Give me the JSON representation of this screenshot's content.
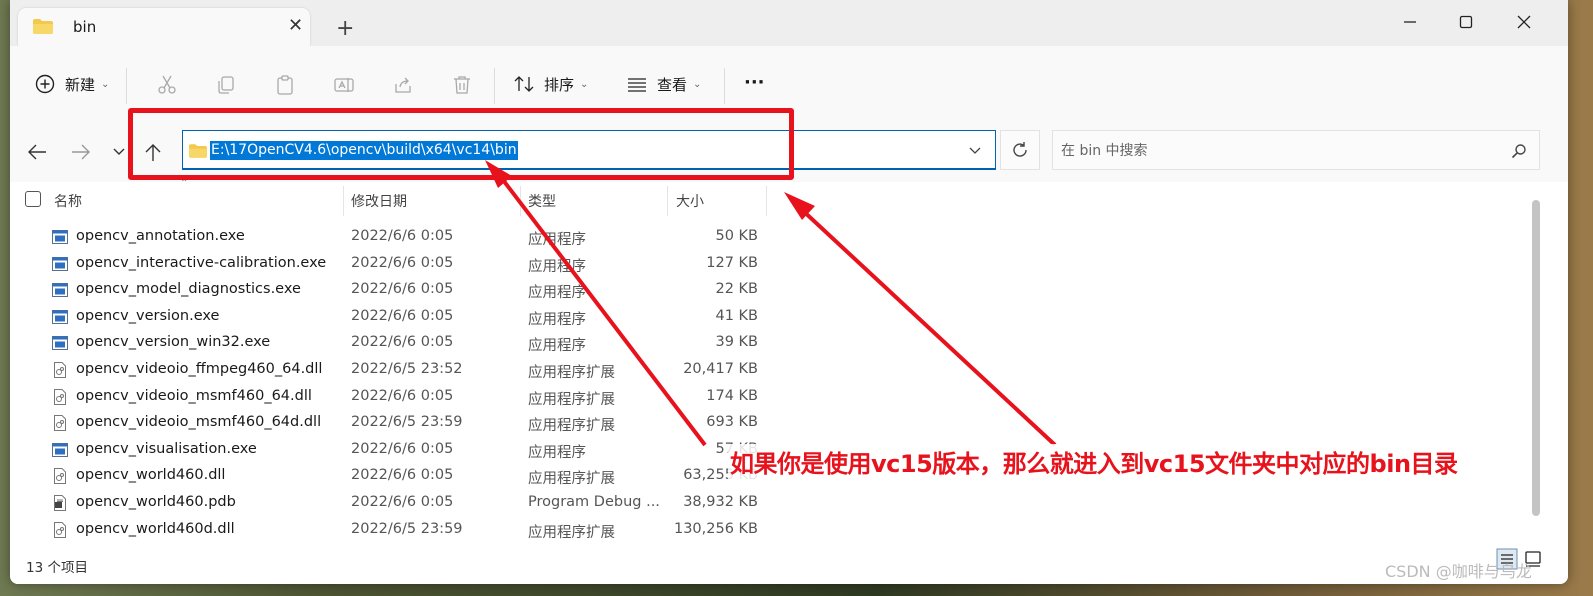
{
  "tab": {
    "title": "bin"
  },
  "toolbar": {
    "new_label": "新建",
    "sort_label": "排序",
    "view_label": "查看",
    "more_label": "···"
  },
  "address": {
    "path": "E:\\17OpenCV4.6\\opencv\\build\\x64\\vc14\\bin"
  },
  "search": {
    "placeholder": "在 bin 中搜索"
  },
  "columns": {
    "name": "名称",
    "date": "修改日期",
    "type": "类型",
    "size": "大小"
  },
  "files": [
    {
      "name": "opencv_annotation.exe",
      "date": "2022/6/6 0:05",
      "type": "应用程序",
      "size": "50 KB",
      "icon": "exe"
    },
    {
      "name": "opencv_interactive-calibration.exe",
      "date": "2022/6/6 0:05",
      "type": "应用程序",
      "size": "127 KB",
      "icon": "exe"
    },
    {
      "name": "opencv_model_diagnostics.exe",
      "date": "2022/6/6 0:05",
      "type": "应用程序",
      "size": "22 KB",
      "icon": "exe"
    },
    {
      "name": "opencv_version.exe",
      "date": "2022/6/6 0:05",
      "type": "应用程序",
      "size": "41 KB",
      "icon": "exe"
    },
    {
      "name": "opencv_version_win32.exe",
      "date": "2022/6/6 0:05",
      "type": "应用程序",
      "size": "39 KB",
      "icon": "exe"
    },
    {
      "name": "opencv_videoio_ffmpeg460_64.dll",
      "date": "2022/6/5 23:52",
      "type": "应用程序扩展",
      "size": "20,417 KB",
      "icon": "dll"
    },
    {
      "name": "opencv_videoio_msmf460_64.dll",
      "date": "2022/6/6 0:05",
      "type": "应用程序扩展",
      "size": "174 KB",
      "icon": "dll"
    },
    {
      "name": "opencv_videoio_msmf460_64d.dll",
      "date": "2022/6/5 23:59",
      "type": "应用程序扩展",
      "size": "693 KB",
      "icon": "dll"
    },
    {
      "name": "opencv_visualisation.exe",
      "date": "2022/6/6 0:05",
      "type": "应用程序",
      "size": "57 KB",
      "icon": "exe"
    },
    {
      "name": "opencv_world460.dll",
      "date": "2022/6/6 0:05",
      "type": "应用程序扩展",
      "size": "63,255 KB",
      "icon": "dll"
    },
    {
      "name": "opencv_world460.pdb",
      "date": "2022/6/6 0:05",
      "type": "Program Debug ...",
      "size": "38,932 KB",
      "icon": "pdb"
    },
    {
      "name": "opencv_world460d.dll",
      "date": "2022/6/5 23:59",
      "type": "应用程序扩展",
      "size": "130,256 KB",
      "icon": "dll"
    }
  ],
  "status": {
    "count": "13 个项目"
  },
  "annotation": {
    "text": "如果你是使用vc15版本，那么就进入到vc15文件夹中对应的bin目录"
  },
  "watermark": {
    "text": "CSDN @咖啡与乌龙"
  },
  "colors": {
    "accent": "#0078d7",
    "annotation_red": "#e8121c",
    "folder_yellow": "#f2c94c"
  }
}
